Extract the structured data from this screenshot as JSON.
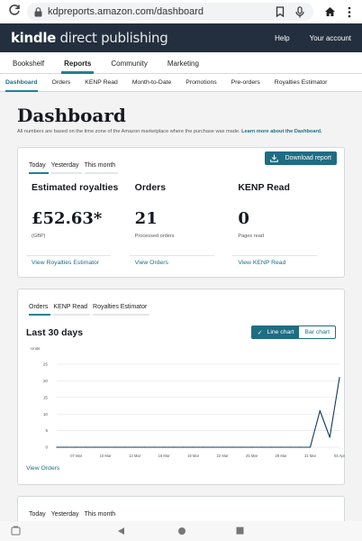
{
  "browser": {
    "url": "kdpreports.amazon.com/dashboard",
    "icons": [
      "reload-icon",
      "lock-icon",
      "bookmark-icon",
      "mic-icon",
      "home-icon",
      "more-icon"
    ]
  },
  "kdp_header": {
    "logo_bold": "kindle",
    "logo_rest": " direct publishing",
    "help": "Help",
    "account": "Your account"
  },
  "main_nav": {
    "tabs": [
      "Bookshelf",
      "Reports",
      "Community",
      "Marketing"
    ],
    "active": "Reports"
  },
  "sub_nav": {
    "tabs": [
      "Dashboard",
      "Orders",
      "KENP Read",
      "Month-to-Date",
      "Promotions",
      "Pre-orders",
      "Royalties Estimator"
    ],
    "active": "Dashboard"
  },
  "dashboard": {
    "title": "Dashboard",
    "note": "All numbers are based on the time zone of the Amazon marketplace where the purchase was made.",
    "note_link": "Learn more about the Dashboard."
  },
  "summary_card": {
    "tabs": [
      "Today",
      "Yesterday",
      "This month"
    ],
    "active_tab": "Today",
    "download_label": "Download report",
    "metrics": [
      {
        "title": "Estimated royalties",
        "value": "£52.63*",
        "sub": "(GBP)",
        "link": "View Royalties Estimator"
      },
      {
        "title": "Orders",
        "value": "21",
        "sub": "Processed orders",
        "link": "View Orders"
      },
      {
        "title": "KENP Read",
        "value": "0",
        "sub": "Pages read",
        "link": "View KENP Read"
      }
    ]
  },
  "chart_card": {
    "tabs": [
      "Orders",
      "KENP Read",
      "Royalties Estimator"
    ],
    "active_tab": "Orders",
    "title": "Last 30 days",
    "toggle": {
      "line": "Line chart",
      "bar": "Bar chart",
      "selected": "Line chart",
      "check": "✓"
    },
    "units_label": "Units",
    "view_link": "View Orders"
  },
  "chart_data": {
    "type": "line",
    "ylabel": "Units",
    "ylim": [
      0,
      25
    ],
    "yticks": [
      0,
      5,
      10,
      15,
      20,
      25
    ],
    "grid": true,
    "xtick_labels": [
      "07 Mar",
      "10 Mar",
      "13 Mar",
      "16 Mar",
      "19 Mar",
      "22 Mar",
      "25 Mar",
      "28 Mar",
      "31 Mar",
      "03 Apr"
    ],
    "x": [
      "05 Mar",
      "06 Mar",
      "07 Mar",
      "08 Mar",
      "09 Mar",
      "10 Mar",
      "11 Mar",
      "12 Mar",
      "13 Mar",
      "14 Mar",
      "15 Mar",
      "16 Mar",
      "17 Mar",
      "18 Mar",
      "19 Mar",
      "20 Mar",
      "21 Mar",
      "22 Mar",
      "23 Mar",
      "24 Mar",
      "25 Mar",
      "26 Mar",
      "27 Mar",
      "28 Mar",
      "29 Mar",
      "30 Mar",
      "31 Mar",
      "01 Apr",
      "02 Apr",
      "03 Apr"
    ],
    "series": [
      {
        "values": [
          0,
          0,
          0,
          0,
          0,
          0,
          0,
          0,
          0,
          0,
          0,
          0,
          0,
          0,
          0,
          0,
          0,
          0,
          0,
          0,
          0,
          0,
          0,
          0,
          0,
          0,
          0,
          11,
          3,
          21
        ]
      }
    ],
    "color": "#0f3a59"
  },
  "bottom_card": {
    "tabs": [
      "Today",
      "Yesterday",
      "This month"
    ],
    "active_tab": "Today"
  },
  "android_nav": {
    "icons": [
      "app-icon",
      "back-icon",
      "home-button-icon",
      "recents-icon"
    ]
  }
}
